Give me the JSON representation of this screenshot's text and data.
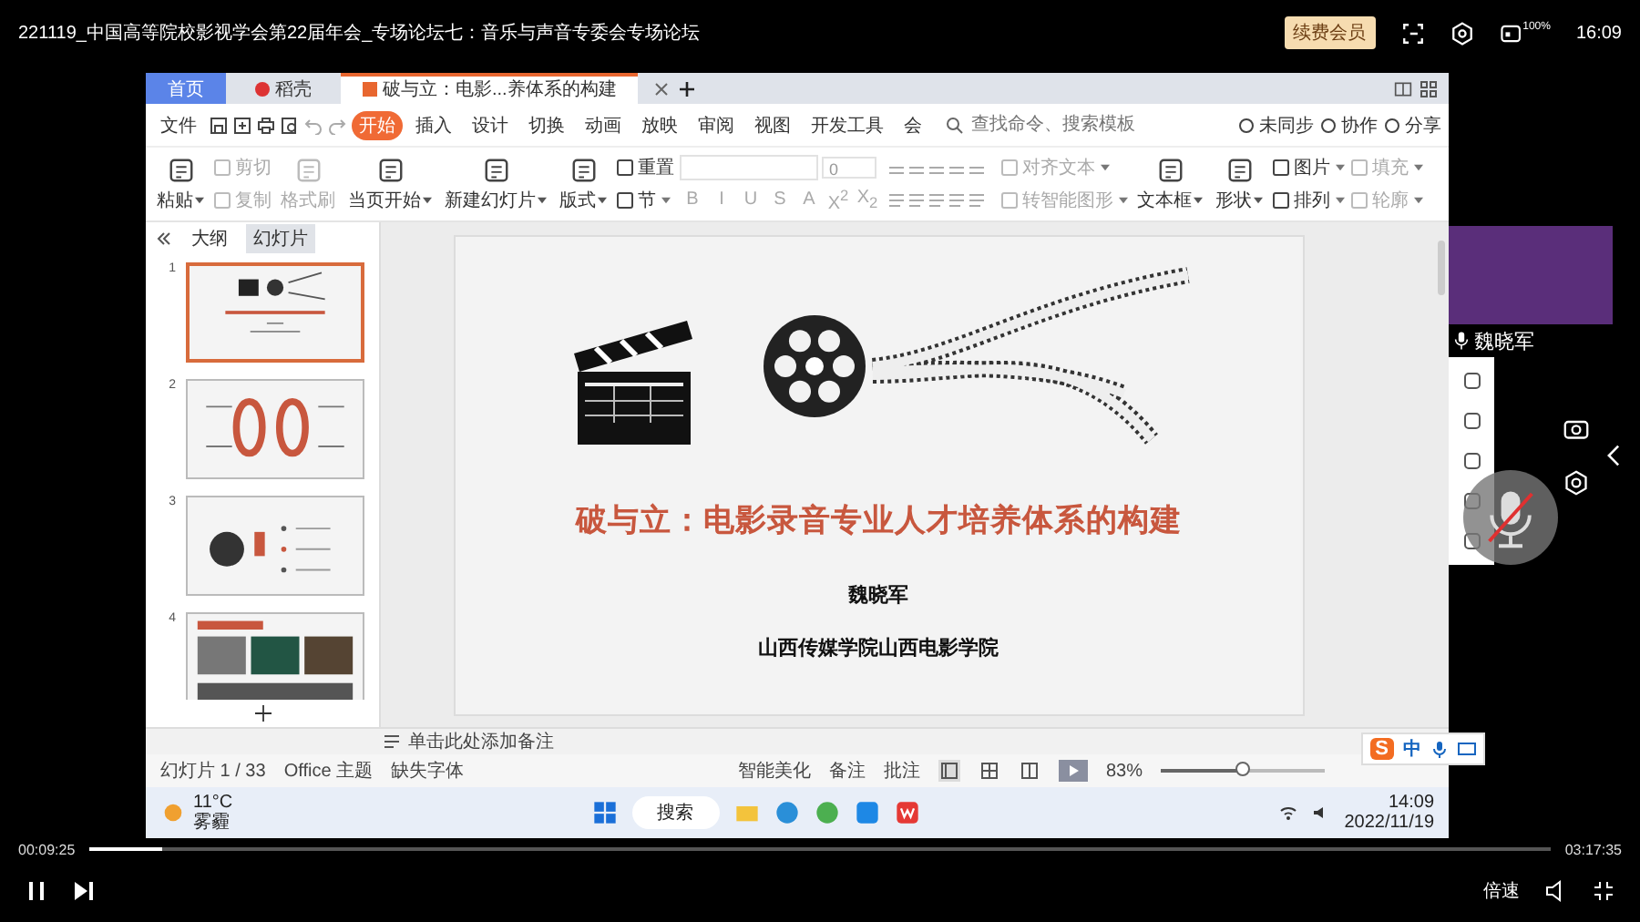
{
  "player": {
    "title": "221119_中国高等院校影视学会第22届年会_专场论坛七：音乐与声音专委会专场论坛",
    "vip_badge": "续费会员",
    "battery": "100%",
    "clock": "16:09",
    "elapsed": "00:09:25",
    "duration": "03:17:35",
    "progress": {
      "level": 0.05
    },
    "speed": "倍速"
  },
  "wps": {
    "tabs": [
      {
        "label": "首页",
        "kind": "home",
        "selected": false
      },
      {
        "label": "稻壳",
        "kind": "docer",
        "selected": false
      },
      {
        "label": "破与立：电影...养体系的构建",
        "kind": "doc",
        "selected": true
      }
    ],
    "file_menu": "文件",
    "menu": [
      {
        "label": "开始",
        "selected": true
      },
      {
        "label": "插入",
        "selected": false
      },
      {
        "label": "设计",
        "selected": false
      },
      {
        "label": "切换",
        "selected": false
      },
      {
        "label": "动画",
        "selected": false
      },
      {
        "label": "放映",
        "selected": false
      },
      {
        "label": "审阅",
        "selected": false
      },
      {
        "label": "视图",
        "selected": false
      },
      {
        "label": "开发工具",
        "selected": false
      },
      {
        "label": "会",
        "selected": false
      }
    ],
    "search": {
      "placeholder": "查找命令、搜索模板"
    },
    "actions": [
      "未同步",
      "协作",
      "分享"
    ],
    "ribbon": [
      {
        "kind": "big",
        "items": [
          {
            "label": "粘贴",
            "dropdown": true,
            "disabled": false
          }
        ]
      },
      {
        "kind": "pair",
        "items": [
          {
            "label": "剪切",
            "dropdown": false,
            "disabled": true
          },
          {
            "label": "复制",
            "dropdown": false,
            "disabled": true
          }
        ]
      },
      {
        "kind": "big",
        "items": [
          {
            "label": "格式刷",
            "dropdown": false,
            "disabled": true
          }
        ]
      },
      {
        "kind": "big",
        "items": [
          {
            "label": "当页开始",
            "dropdown": true,
            "disabled": false
          }
        ]
      },
      {
        "kind": "big",
        "items": [
          {
            "label": "新建幻灯片",
            "dropdown": true,
            "disabled": false
          }
        ]
      },
      {
        "kind": "big",
        "items": [
          {
            "label": "版式",
            "dropdown": true,
            "disabled": false
          }
        ]
      },
      {
        "kind": "pair",
        "items": [
          {
            "label": "重置",
            "dropdown": false,
            "disabled": false
          },
          {
            "label": "节",
            "dropdown": true,
            "disabled": false
          }
        ]
      },
      {
        "kind": "font",
        "size": "0",
        "glyphs": [
          "B",
          "I",
          "U",
          "S",
          "A",
          "X$^{2}$",
          "X$_{2}$"
        ]
      },
      {
        "kind": "para"
      },
      {
        "kind": "pair",
        "items": [
          {
            "label": "对齐文本",
            "dropdown": true,
            "disabled": true
          },
          {
            "label": "转智能图形",
            "dropdown": true,
            "disabled": true
          }
        ]
      },
      {
        "kind": "big",
        "items": [
          {
            "label": "文本框",
            "dropdown": true,
            "disabled": false
          }
        ]
      },
      {
        "kind": "big",
        "items": [
          {
            "label": "形状",
            "dropdown": true,
            "disabled": false
          }
        ]
      },
      {
        "kind": "pair",
        "items": [
          {
            "label": "图片",
            "dropdown": true,
            "disabled": false
          },
          {
            "label": "排列",
            "dropdown": true,
            "disabled": false
          }
        ]
      },
      {
        "kind": "pair",
        "items": [
          {
            "label": "填充",
            "dropdown": true,
            "disabled": true
          },
          {
            "label": "轮廓",
            "dropdown": true,
            "disabled": true
          }
        ]
      }
    ],
    "panel_tabs": [
      {
        "label": "大纲",
        "selected": false
      },
      {
        "label": "幻灯片",
        "selected": true
      }
    ],
    "thumbnails": [
      {
        "number": "1",
        "selected": true
      },
      {
        "number": "2",
        "selected": false
      },
      {
        "number": "3",
        "selected": false
      },
      {
        "number": "4",
        "selected": false
      }
    ],
    "slide": {
      "title": "破与立：电影录音专业人才培养体系的构建",
      "author": "魏晓军",
      "institution": "山西传媒学院山西电影学院"
    },
    "notes_placeholder": "单击此处添加备注",
    "status": {
      "slide_count": "幻灯片 1 / 33",
      "theme": "Office 主题",
      "missing_font": "缺失字体",
      "beautify": "智能美化",
      "notes": "备注",
      "comments": "批注",
      "views": [
        {
          "selected": true
        },
        {
          "selected": false
        },
        {
          "selected": false
        }
      ],
      "zoom": "83%",
      "zoom_slider": {
        "level": 0.5
      }
    },
    "ime": {
      "logo": "S",
      "mode": "中"
    },
    "taskbar": {
      "temperature": "11°C",
      "weather": "雾霾",
      "search": "搜索",
      "time": "14:09",
      "date": "2022/11/19"
    }
  },
  "camera": {
    "name": "魏晓军"
  }
}
